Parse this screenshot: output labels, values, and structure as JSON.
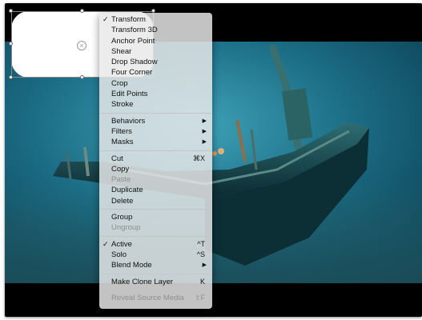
{
  "menu": {
    "group_transform": [
      {
        "label": "Transform",
        "checked": true
      },
      {
        "label": "Transform 3D"
      },
      {
        "label": "Anchor Point"
      },
      {
        "label": "Shear"
      },
      {
        "label": "Drop Shadow"
      },
      {
        "label": "Four Corner"
      },
      {
        "label": "Crop"
      },
      {
        "label": "Edit Points"
      },
      {
        "label": "Stroke"
      }
    ],
    "group_submenus": [
      {
        "label": "Behaviors",
        "submenu": true
      },
      {
        "label": "Filters",
        "submenu": true
      },
      {
        "label": "Masks",
        "submenu": true
      }
    ],
    "group_edit": [
      {
        "label": "Cut",
        "shortcut": "⌘X"
      },
      {
        "label": "Copy"
      },
      {
        "label": "Paste",
        "disabled": true
      },
      {
        "label": "Duplicate"
      },
      {
        "label": "Delete"
      }
    ],
    "group_group": [
      {
        "label": "Group"
      },
      {
        "label": "Ungroup",
        "disabled": true
      }
    ],
    "group_layer": [
      {
        "label": "Active",
        "checked": true,
        "shortcut": "^T"
      },
      {
        "label": "Solo",
        "shortcut": "^S"
      },
      {
        "label": "Blend Mode",
        "submenu": true
      }
    ],
    "group_clone": [
      {
        "label": "Make Clone Layer",
        "shortcut": "K"
      }
    ],
    "group_reveal": [
      {
        "label": "Reveal Source Media",
        "shortcut": "⇧F",
        "disabled": true
      }
    ],
    "check_glyph": "✓",
    "submenu_glyph": "▶"
  },
  "canvas": {
    "anchor_glyph": "×",
    "background_color": "#000000",
    "water_color": "#1d6f86"
  }
}
